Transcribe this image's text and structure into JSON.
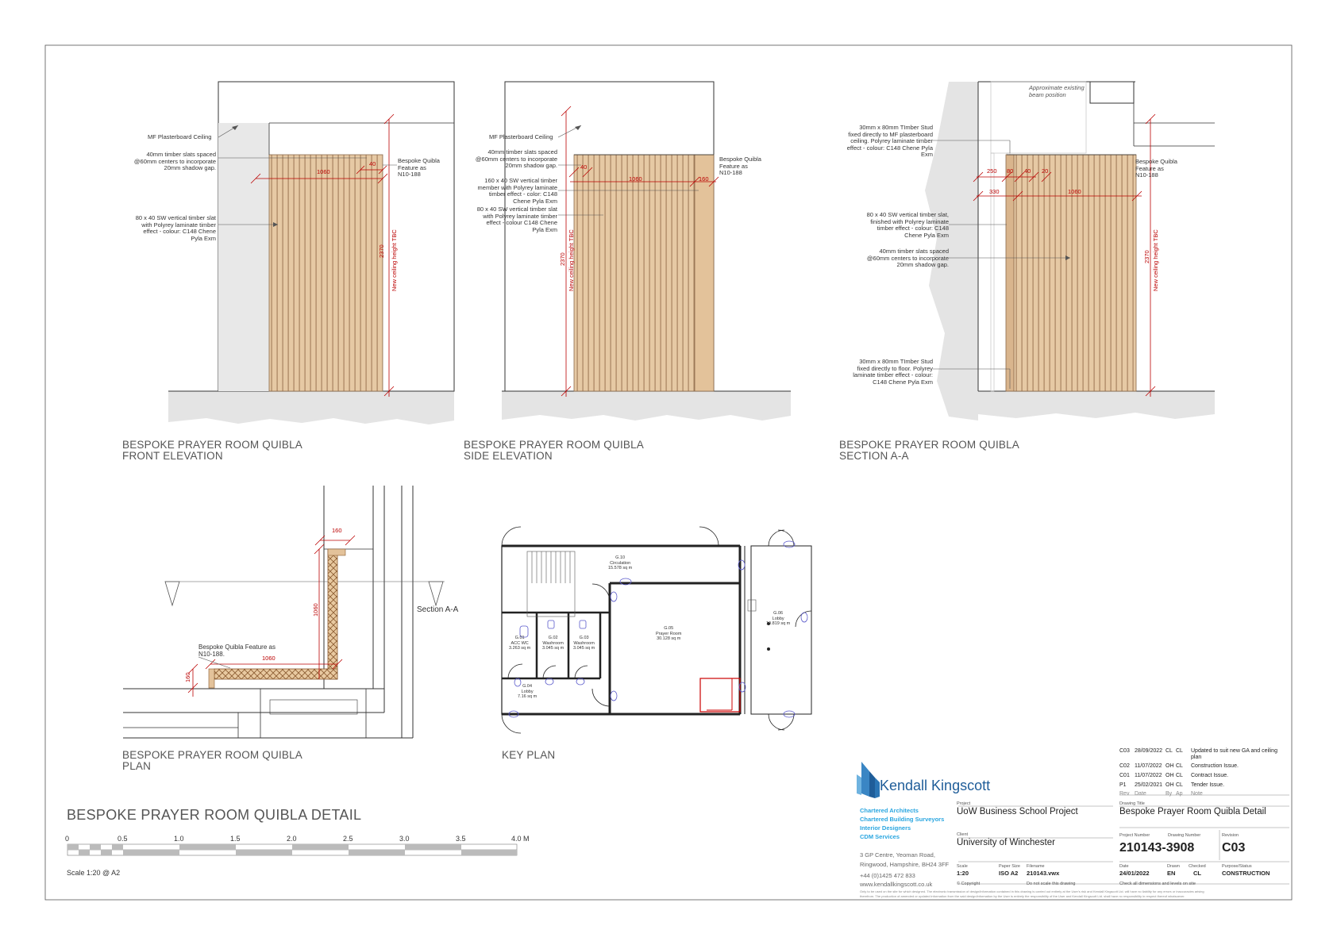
{
  "views": {
    "front": {
      "title1": "BESPOKE PRAYER ROOM QUIBLA",
      "title2": "FRONT ELEVATION"
    },
    "side": {
      "title1": "BESPOKE PRAYER ROOM QUIBLA",
      "title2": "SIDE ELEVATION"
    },
    "section": {
      "title1": "BESPOKE PRAYER ROOM QUIBLA",
      "title2": "SECTION A-A"
    },
    "plan": {
      "title1": "BESPOKE PRAYER ROOM QUIBLA",
      "title2": "PLAN"
    },
    "key": {
      "title1": "KEY PLAN"
    }
  },
  "annotations": {
    "mf_ceiling": "MF Plasterboard Ceiling",
    "slats_40": "40mm timber slats spaced\n@60mm centers to incorporate\n20mm shadow gap.",
    "slat_80x40": "80 x 40 SW vertical timber slat\nwith Polyrey laminate timber\neffect - colour: C148 Chene\nPyla Exm",
    "bespoke_feature": "Bespoke Quibla\nFeature as\nN10-188",
    "member_160": "160 x 40 SW vertical timber\nmember with Polyrey laminate\ntimber effect - color: C148\nChene Pyla Exm",
    "slat_80x40_side": "80 x 40 SW vertical timber slat\nwith Polyrey laminate timber\neffect - colour C148 Chene\nPyla Exm",
    "stud_top": "30mm x 80mm TImber Stud\nfixed directly to MF plasterboard\nceiling. Polyrey laminate timber\neffect - colour: C148 Chene Pyla\nExm",
    "slat_finished": "80 x 40 SW vertical timber slat,\nfinished with Polyrey laminate\ntimber effect - colour: C148\nChene Pyla Exm",
    "slats_40_section": "40mm timber slats spaced\n@60mm centers to incorporate\n20mm shadow gap.",
    "stud_floor": "30mm x 80mm TImber Stud\nfixed directly to floor. Polyrey\nlaminate timber effect - colour:\nC148 Chene Pyla Exm",
    "beam": "Approximate existing\nbeam position",
    "bespoke_plan": "Bespoke Quibla Feature as\nN10-188.",
    "section_aa": "Section A-A",
    "ceiling_height": "New ceiling height TBC"
  },
  "dims": {
    "w1060": "1060",
    "d40": "40",
    "h2370": "2370",
    "d160": "160",
    "d250": "250",
    "d80": "80",
    "d20": "20",
    "d330": "330"
  },
  "keyplan": {
    "circulation": "G.10\nCirculation\n15.578 sq m",
    "prayer": "G.05\nPrayer Room\n30.128 sq m",
    "lobby6": "G.06\nLobby\n19.819 sq m",
    "acc": "G.01\nACC WC\n3.263 sq m",
    "wash2": "G.02\nWashroom\n3.045 sq m",
    "wash3": "G.03\nWashroom\n3.045 sq m",
    "lobby4": "G.04\nLobby\n7.16 sq m"
  },
  "drawing_title": "BESPOKE PRAYER ROOM QUIBLA DETAIL",
  "scale_bar": {
    "ticks": [
      "0",
      "0.5",
      "1.0",
      "1.5",
      "2.0",
      "2.5",
      "3.0",
      "3.5",
      "4.0 M"
    ],
    "note": "Scale 1:20 @ A2"
  },
  "company": {
    "name": "Kendall Kingscott",
    "services": [
      "Chartered Architects",
      "Chartered Building Surveyors",
      "Interior Designers",
      "CDM Services"
    ],
    "address": "3 GP Centre, Yeoman Road,\nRingwood, Hampshire, BH24 3FF",
    "phone": "+44 (0)1425 472 833",
    "web": "www.kendallkingscott.co.uk",
    "brand_color": "#2aa6e0"
  },
  "title_block": {
    "project_label": "Project",
    "project": "UoW Business School Project",
    "client_label": "Client",
    "client": "University of Winchester",
    "drawing_title_label": "Drawing Title",
    "drawing_title": "Bespoke Prayer Room Quibla Detail",
    "project_number_label": "Project Number",
    "project_number": "210143-3908",
    "drawing_number_label": "Drawing Number",
    "revision_label": "Revision",
    "revision": "C03",
    "scale_label": "Scale",
    "scale": "1:20",
    "paper_label": "Paper Size",
    "paper": "ISO A2",
    "filename_label": "Filename",
    "filename": "210143.vwx",
    "date_label": "Date",
    "date": "24/01/2022",
    "drawn_label": "Drawn",
    "drawn": "EN",
    "checked_label": "Checked",
    "checked": "CL",
    "status_label": "Purpose/Status",
    "status": "CONSTRUCTION",
    "copyright": "© Copyright",
    "noscale": "Do not scale this drawing",
    "check": "Check all dimensions and levels on site",
    "disclaimer1": "Only to be used on the site for which designed. The electronic transmission of design/information contained in this drawing is carried out entirely at the User's risk and Kendall Kingscott Ltd. will have no liability for any errors or inaccuracies arising",
    "disclaimer2": "therefrom. The production of amended or updated information from the said design/information by the User is entirely the responsibility of the User and Kendall Kingscott Ltd. shall have no responsibility in respect thereof whatsoever."
  },
  "revisions": [
    {
      "rev": "C03",
      "date": "28/09/2022",
      "by": "CL",
      "ap": "CL",
      "note": "Updated to suit new GA and ceiling",
      "note2": "plan"
    },
    {
      "rev": "C02",
      "date": "11/07/2022",
      "by": "OH",
      "ap": "CL",
      "note": "Construction Issue."
    },
    {
      "rev": "C01",
      "date": "11/07/2022",
      "by": "OH",
      "ap": "CL",
      "note": "Contract Issue."
    },
    {
      "rev": "P1",
      "date": "25/02/2021",
      "by": "OH",
      "ap": "CL",
      "note": "Tender Issue."
    }
  ],
  "revision_headers": {
    "rev": "Rev",
    "date": "Date",
    "by": "By",
    "ap": "Ap",
    "note": "Note"
  }
}
